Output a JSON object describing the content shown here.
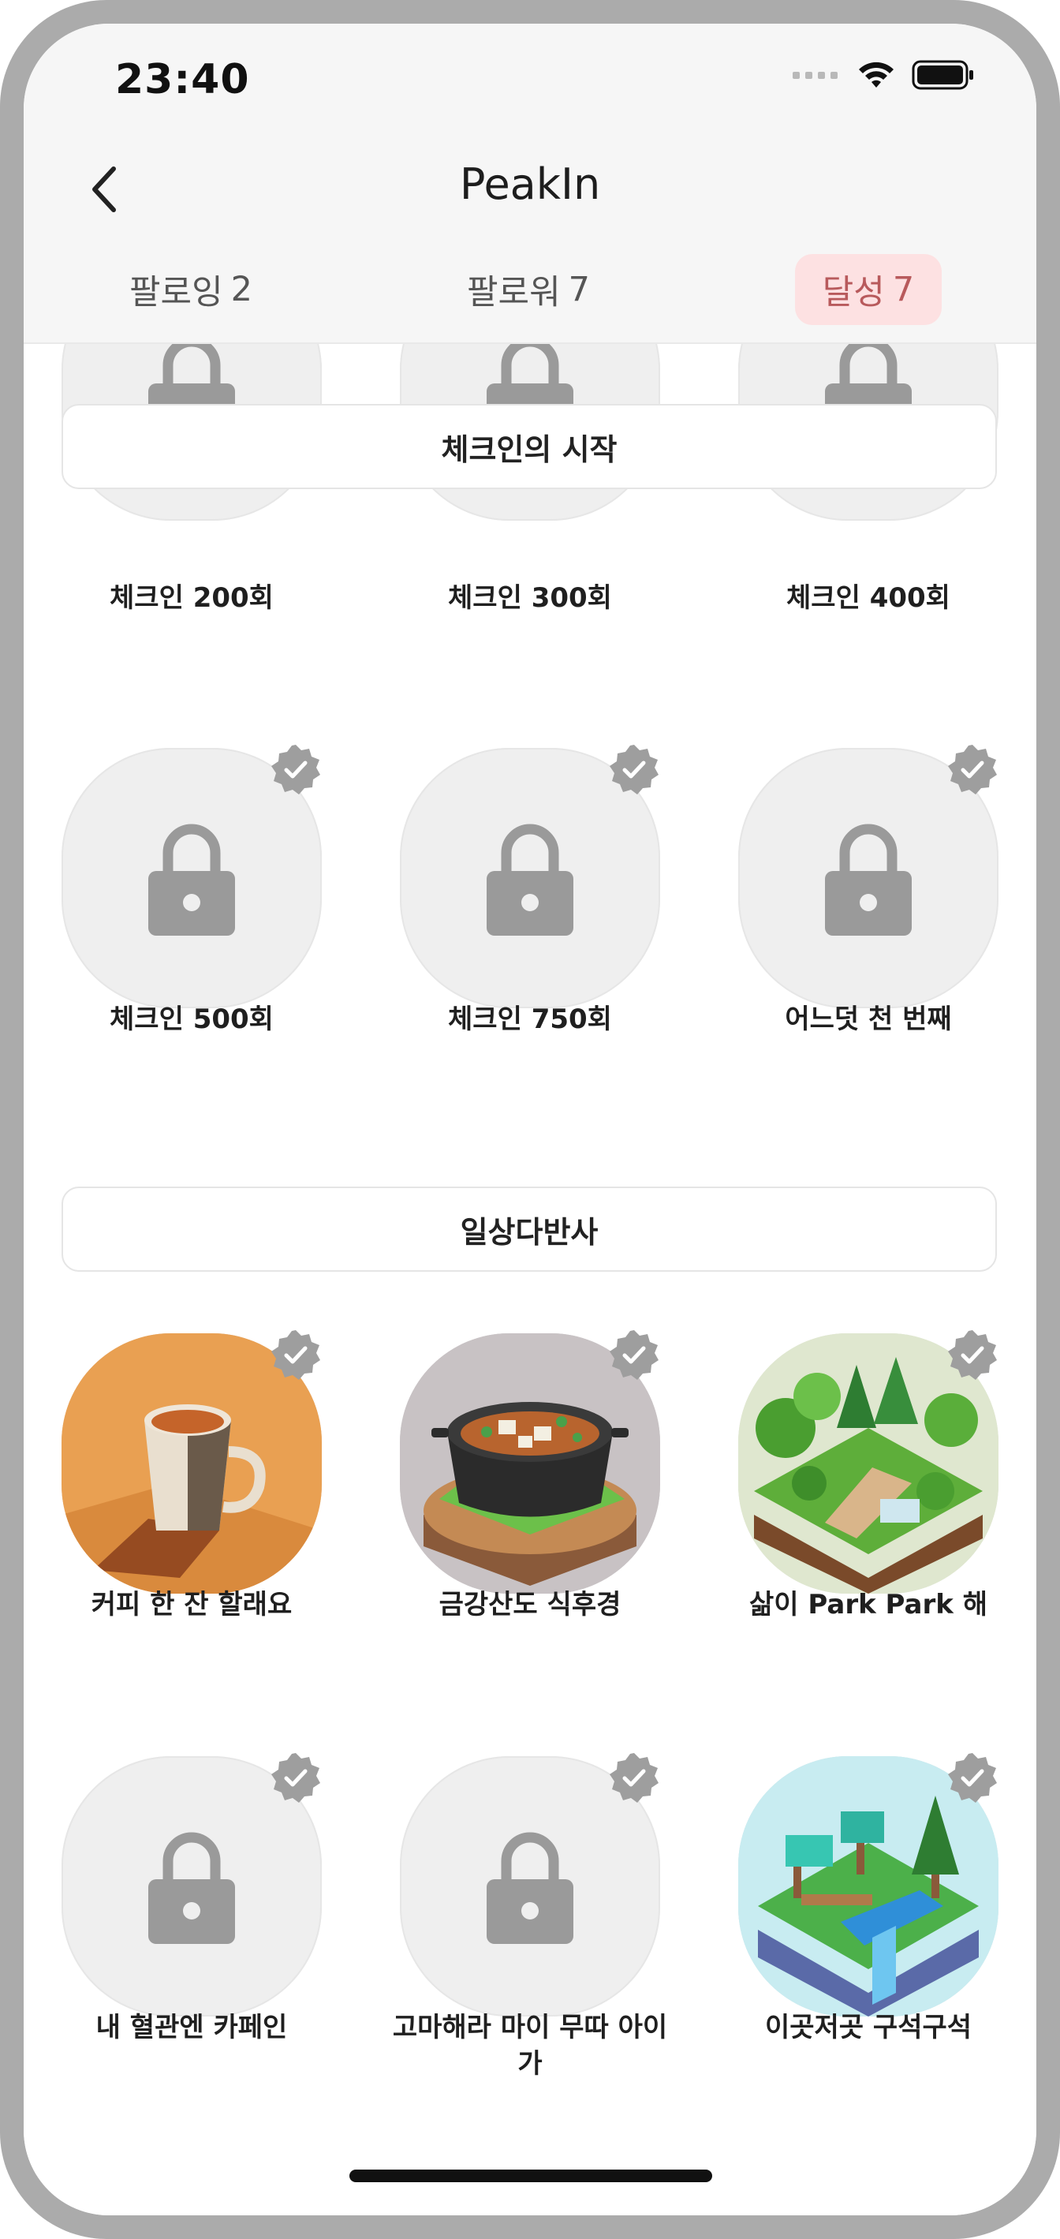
{
  "status_bar": {
    "time": "23:40"
  },
  "header": {
    "title": "PeakIn"
  },
  "tabs": [
    {
      "label": "팔로잉",
      "count": "2"
    },
    {
      "label": "팔로워",
      "count": "7"
    },
    {
      "label": "달성",
      "count": "7",
      "active": true
    }
  ],
  "sections": [
    {
      "title": "체크인의 시작",
      "badges": [
        {
          "label": "체크인 200회",
          "icon": "lock-icon"
        },
        {
          "label": "체크인 300회",
          "icon": "lock-icon"
        },
        {
          "label": "체크인 400회",
          "icon": "lock-icon"
        },
        {
          "label": "체크인 500회",
          "icon": "lock-icon",
          "achieved": true
        },
        {
          "label": "체크인 750회",
          "icon": "lock-icon",
          "achieved": true
        },
        {
          "label": "어느덧 천 번째",
          "icon": "lock-icon",
          "achieved": true
        }
      ]
    },
    {
      "title": "일상다반사",
      "badges": [
        {
          "label": "커피 한 잔 할래요",
          "icon": "coffee-cup-icon",
          "achieved": true
        },
        {
          "label": "금강산도 식후경",
          "icon": "stew-pot-icon",
          "achieved": true
        },
        {
          "label": "삶이 Park Park  해",
          "icon": "park-island-icon",
          "achieved": true
        },
        {
          "label": "내 혈관엔 카페인",
          "icon": "lock-icon",
          "achieved": true
        },
        {
          "label": "고마해라 마이 무따 아이가",
          "icon": "lock-icon",
          "achieved": true
        },
        {
          "label": "이곳저곳 구석구석",
          "icon": "forest-island-icon",
          "achieved": true
        }
      ]
    }
  ],
  "colors": {
    "accent_bg": "#fde1e2",
    "accent_text": "#b85a5c",
    "badge_bg": "#efefef",
    "lock": "#9a9a9a"
  }
}
